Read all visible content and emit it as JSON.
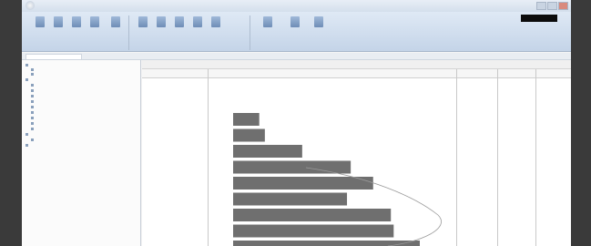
{
  "titlebar": {
    "title": ""
  },
  "ribbon": {
    "buttons": [
      "",
      "",
      "",
      "",
      "",
      "",
      "",
      "",
      "",
      "",
      "",
      "",
      ""
    ],
    "groups": [
      "",
      "",
      ""
    ]
  },
  "sidebar": {
    "items": [
      "",
      "",
      "",
      "",
      "",
      "",
      "",
      "",
      "",
      "",
      "",
      "",
      "",
      "",
      "",
      ""
    ]
  },
  "main": {
    "breadcrumb": "",
    "columns": [
      "",
      "",
      "",
      "",
      ""
    ],
    "chart_bars": [
      0.28,
      0.34,
      0.74,
      1.26,
      1.5,
      1.22,
      1.69,
      1.72,
      2.0
    ]
  },
  "colors": {
    "titlebar": "#d4dfec",
    "ribbon": "#c4d4e8",
    "bar": "#6f6f6f",
    "background": "#3a3a3a"
  }
}
